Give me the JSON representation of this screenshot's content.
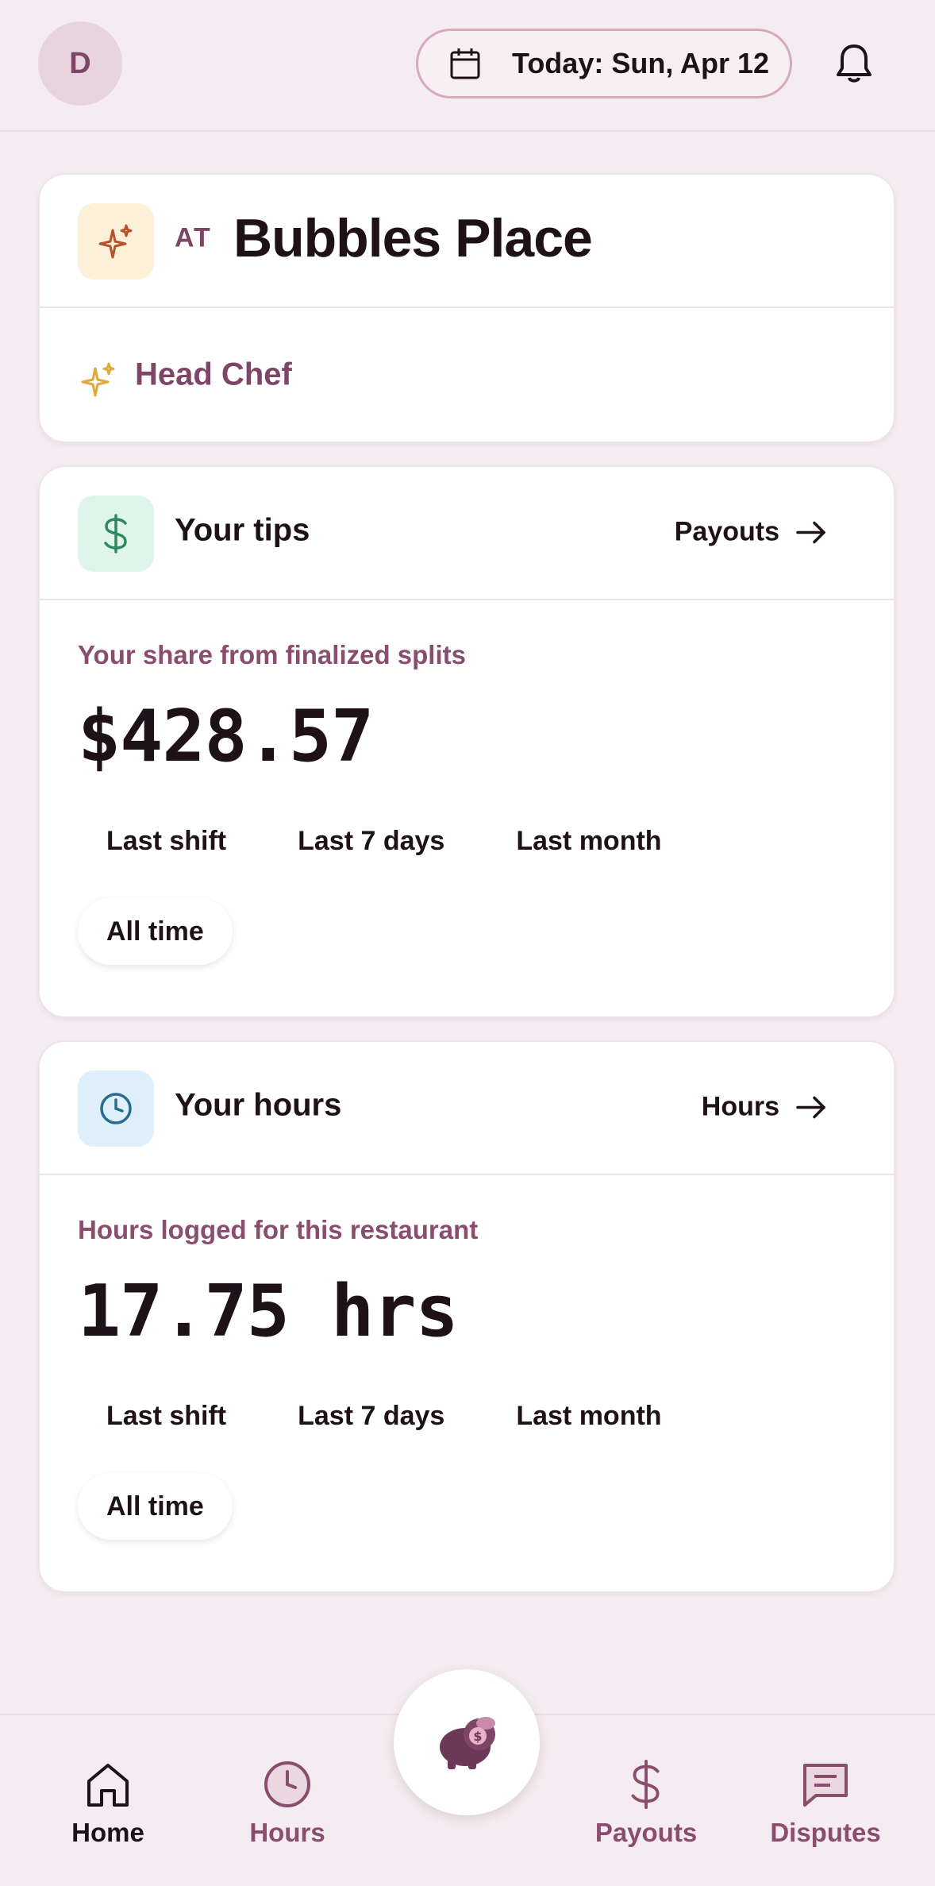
{
  "header": {
    "avatar_initial": "D",
    "date_label": "Today: Sun, Apr 12"
  },
  "location_card": {
    "at_label": "AT",
    "place_name": "Bubbles Place",
    "role": "Head Chef"
  },
  "tips_card": {
    "title": "Your tips",
    "link_label": "Payouts",
    "subtitle": "Your share from finalized splits",
    "value": "$428.57",
    "filters": [
      {
        "label": "Last shift",
        "active": false
      },
      {
        "label": "Last 7 days",
        "active": false
      },
      {
        "label": "Last month",
        "active": false
      },
      {
        "label": "All time",
        "active": true
      }
    ]
  },
  "hours_card": {
    "title": "Your hours",
    "link_label": "Hours",
    "subtitle": "Hours logged for this restaurant",
    "value": "17.75 hrs",
    "filters": [
      {
        "label": "Last shift",
        "active": false
      },
      {
        "label": "Last 7 days",
        "active": false
      },
      {
        "label": "Last month",
        "active": false
      },
      {
        "label": "All time",
        "active": true
      }
    ]
  },
  "nav": {
    "items": [
      {
        "label": "Home",
        "icon": "home-icon",
        "active": true
      },
      {
        "label": "Hours",
        "icon": "clock-icon",
        "active": false
      },
      {
        "label": "Payouts",
        "icon": "dollar-icon",
        "active": false
      },
      {
        "label": "Disputes",
        "icon": "message-icon",
        "active": false
      }
    ],
    "center_icon": "piggy-bank-icon"
  },
  "colors": {
    "background": "#f5edf1",
    "accent": "#7d4566",
    "tips_icon_bg": "#dff5ec",
    "hours_icon_bg": "#dff0fb",
    "place_icon_bg": "#fdf0d9"
  }
}
